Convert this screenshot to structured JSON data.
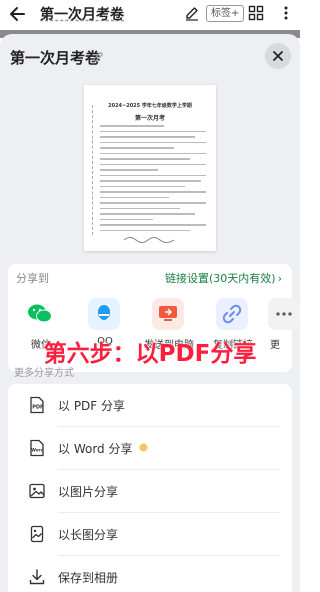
{
  "app_bar": {
    "title": "第一次月考卷",
    "tag_label": "标签",
    "tag_plus": "+"
  },
  "sheet": {
    "title": "第一次月考卷",
    "preview": {
      "header": "2024~2025 学年七年级数学上学期",
      "subtitle": "第一次月考"
    }
  },
  "share": {
    "label": "分享到",
    "link_settings": "链接设置(30天内有效)",
    "targets": [
      {
        "label": "微信",
        "icon": "wechat-icon",
        "color": "#07c160"
      },
      {
        "label": "QQ",
        "icon": "qq-icon",
        "color": "#1f9bf0"
      },
      {
        "label": "发送到电脑",
        "icon": "send-to-computer-icon",
        "color": "#f05a3e"
      },
      {
        "label": "复制链接",
        "icon": "link-icon",
        "color": "#6b8cf0"
      },
      {
        "label": "更",
        "icon": "more-icon",
        "color": "#555555"
      }
    ]
  },
  "overlay": {
    "caption": "第六步：以PDF分享"
  },
  "more_ways": {
    "label": "更多分享方式",
    "items": [
      {
        "label": "以 PDF 分享",
        "icon": "pdf-icon"
      },
      {
        "label": "以 Word 分享",
        "icon": "word-icon",
        "badge": "vip-badge"
      },
      {
        "label": "以图片分享",
        "icon": "image-icon"
      },
      {
        "label": "以长图分享",
        "icon": "long-image-icon"
      },
      {
        "label": "保存到相册",
        "icon": "download-icon"
      }
    ]
  },
  "colors": {
    "accent_green": "#1a7f43",
    "caption_red": "#ff1f3d",
    "sheet_bg": "#eeeff2"
  }
}
